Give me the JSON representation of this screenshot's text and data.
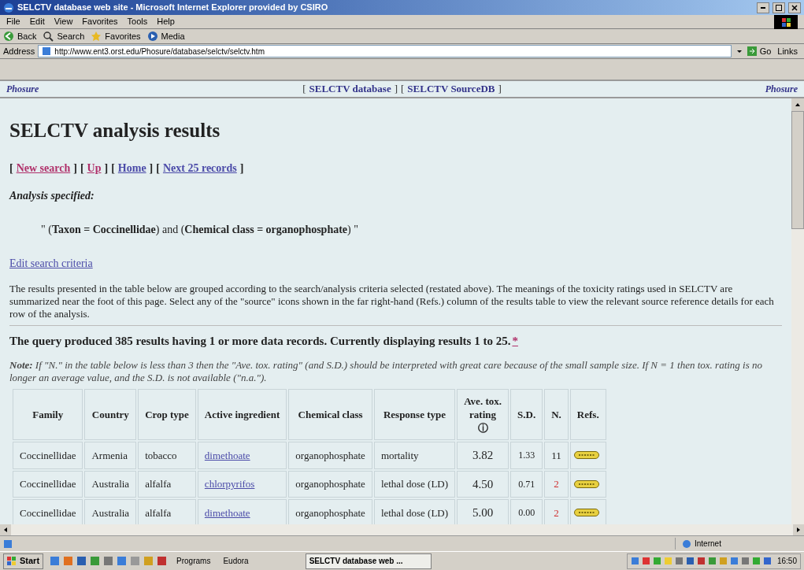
{
  "window": {
    "title": "SELCTV database web site - Microsoft Internet Explorer provided by CSIRO"
  },
  "menu": [
    "File",
    "Edit",
    "View",
    "Favorites",
    "Tools",
    "Help"
  ],
  "toolbar": [
    {
      "kind": "back",
      "label": "Back"
    },
    {
      "kind": "search",
      "label": "Search"
    },
    {
      "kind": "favorites",
      "label": "Favorites"
    },
    {
      "kind": "media",
      "label": "Media"
    }
  ],
  "address": {
    "label": "Address",
    "value": "http://www.ent3.orst.edu/Phosure/database/selctv/selctv.htm",
    "go": "Go",
    "links": "Links"
  },
  "frame_top": {
    "left": "Phosure",
    "links": [
      {
        "open": "[",
        "label": "SELCTV database",
        "close": "]"
      },
      {
        "open": "[",
        "label": "SELCTV SourceDB",
        "close": "]"
      }
    ],
    "right": "Phosure"
  },
  "page": {
    "heading": "SELCTV analysis results",
    "nav_links": [
      {
        "open": "[",
        "label": "New search",
        "close": "]",
        "visited": true
      },
      {
        "open": "[",
        "label": "Up",
        "close": "]",
        "visited": true
      },
      {
        "open": "[",
        "label": "Home",
        "close": "]",
        "visited": false
      },
      {
        "open": "[",
        "label": "Next 25 records",
        "close": "]",
        "visited": false
      }
    ],
    "analysis_label": "Analysis specified:",
    "criteria": "\" (**Taxon = Coccinellidae**) and (**Chemical class = organophosphate**) \"",
    "edit_link": "Edit search criteria",
    "intro": "The results presented in the table below are grouped according to the search/analysis criteria selected (restated above). The meanings of the toxicity ratings used in SELCTV are summarized near the foot of this page. Select any of the \"source\" icons shown in the far right-hand (Refs.) column of the results table to view the relevant source reference details for each row of the analysis.",
    "summary": "The query produced 385 results having 1 or more data records. Currently displaying results 1 to 25.",
    "summary_link": "*",
    "note": "**Note:** If \"N.\" in the table below is less than 3 then the \"Ave. tox. rating\" (and S.D.) should be interpreted with great care because of the small sample size. If N = 1 then tox. rating is no longer an average value, and the S.D. is not available (\"n.a.\").",
    "table": {
      "columns": [
        "Family",
        "Country",
        "Crop type",
        "Active ingredient",
        "Chemical class",
        "Response type",
        "Ave. tox. rating ⓘ",
        "S.D.",
        "N.",
        "Refs."
      ],
      "rows": [
        {
          "family": "Coccinellidae",
          "country": "Armenia",
          "crop": "tobacco",
          "ingredient": "dimethoate",
          "class": "organophosphate",
          "response": "mortality",
          "rating": "3.82",
          "sd": "1.33",
          "n": "11",
          "low_n": false
        },
        {
          "family": "Coccinellidae",
          "country": "Australia",
          "crop": "alfalfa",
          "ingredient": "chlorpyrifos",
          "class": "organophosphate",
          "response": "lethal dose (LD)",
          "rating": "4.50",
          "sd": "0.71",
          "n": "2",
          "low_n": true
        },
        {
          "family": "Coccinellidae",
          "country": "Australia",
          "crop": "alfalfa",
          "ingredient": "dimethoate",
          "class": "organophosphate",
          "response": "lethal dose (LD)",
          "rating": "5.00",
          "sd": "0.00",
          "n": "2",
          "low_n": true
        }
      ]
    }
  },
  "status_bar": {
    "zone": "Internet"
  },
  "taskbar": {
    "start": "Start",
    "programs": "Programs",
    "eudora": "Eudora",
    "task": "SELCTV database web ...",
    "clock": "16:50"
  }
}
